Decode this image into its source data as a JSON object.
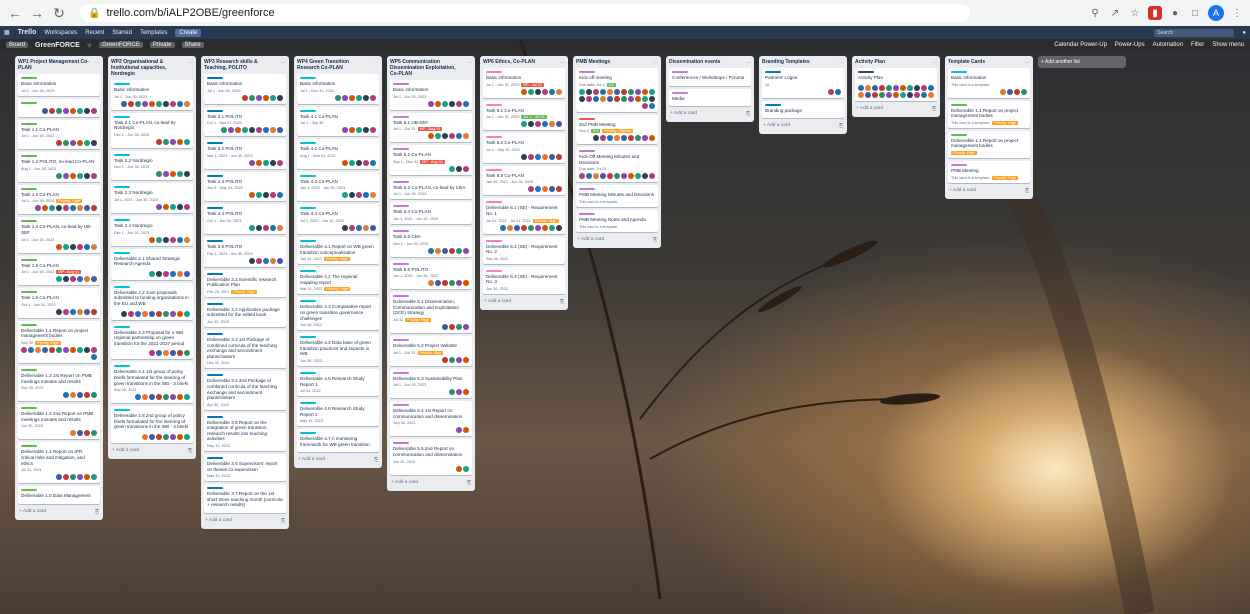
{
  "browser": {
    "url": "trello.com/b/iALP2OBE/greenforce",
    "back_icon": "arrow-left-icon",
    "profile_initial": "A"
  },
  "topbar": {
    "logo": "Trello",
    "workspaces": "Workspaces",
    "recent": "Recent",
    "starred": "Starred",
    "templates": "Templates",
    "create": "Create",
    "search": "Search"
  },
  "board": {
    "view": "Board",
    "title": "GreenFORCE",
    "workspace": "GreenFORCE",
    "private": "Private",
    "share": "Share",
    "calendar": "Calendar Power-Up",
    "powerups": "Power-Ups",
    "automation": "Automation",
    "filter": "Filter",
    "show_menu": "Show menu"
  },
  "add_card_label": "+ Add a card",
  "add_list_label": "+ Add another list",
  "lists": [
    {
      "title": "WP1 Project Management Co-PLAN",
      "cards": [
        {
          "title": "Basic information",
          "label": "#61bd4f",
          "badges": "Jul 1 - Jun 30, 2023",
          "avatars": 0
        },
        {
          "title": "",
          "label": "#61bd4f",
          "badges": "",
          "avatars": 8
        },
        {
          "title": "Task 1.1 Co-PLAN",
          "label": "#61bd4f",
          "badges": "Jul 1 - Jun 30, 2023",
          "avatars": 6
        },
        {
          "title": "Task 1.2 POLITO, no lead Co-PLAN",
          "label": "#61bd4f",
          "badges": "Aug 1 - Jun 30, 2023",
          "avatars": 6
        },
        {
          "title": "Task 1.3 Co-PLAN",
          "label": "#61bd4f",
          "badges": "Jul 1 - Jun 30, 2023",
          "prio": "Priority: High",
          "avatars": 9
        },
        {
          "title": "Task 1.4 Co-PLAN, co-lead by UB-SEF",
          "label": "#61bd4f",
          "badges": "Jul 1 - Jun 30, 2023",
          "avatars": 6
        },
        {
          "title": "Task 1.5 Co-PLAN",
          "label": "#61bd4f",
          "badges": "Jul 1 - Jun 30, 2023",
          "red": "MP - Aug 01",
          "avatars": 6
        },
        {
          "title": "Task 1.6 Co-PLAN",
          "label": "#61bd4f",
          "badges": "Oct 1 - Jun 30, 2023",
          "avatars": 6
        },
        {
          "title": "Deliverable 1.1 Report on project management bodies",
          "label": "#61bd4f",
          "badges": "Sep 30",
          "prio": "Priority: High",
          "avatars": 12
        },
        {
          "title": "Deliverable 1.2 1st Report on PMB meetings minutes and results",
          "label": "#61bd4f",
          "badges": "Sep 30, 2021",
          "avatars": 5
        },
        {
          "title": "Deliverable 1.3 2nd Report on PMB meetings minutes and results",
          "label": "#61bd4f",
          "badges": "Jun 30, 2023",
          "avatars": 4
        },
        {
          "title": "Deliverable 1.4 Report on IPR, critical risks and mitigation, and ethics",
          "label": "#61bd4f",
          "badges": "Jul 31, 2021",
          "avatars": 6
        },
        {
          "title": "Deliverable 1.5 Data Management",
          "label": "#61bd4f",
          "badges": "",
          "avatars": 0
        }
      ]
    },
    {
      "title": "WP2 Organisational & Institutional capacities, Nordregio",
      "cards": [
        {
          "title": "Basic information",
          "label": "#00c2e0",
          "badges": "Jul 1 - Jun 30, 2023",
          "avatars": 10
        },
        {
          "title": "Task 2.1 Co-PLAN, co-lead by Nordregio",
          "label": "#00c2e0",
          "badges": "Dec 1 - Jun 30, 2023",
          "avatars": 5
        },
        {
          "title": "Task 2.2 Nordregio",
          "label": "#00c2e0",
          "badges": "Nov 1 - Jun 30, 2023",
          "avatars": 5
        },
        {
          "title": "Task 2.3 Nordregio",
          "label": "#00c2e0",
          "badges": "Jul 1, 2021 - Jun 30, 2023",
          "avatars": 5
        },
        {
          "title": "Task 2.4 Nordregio",
          "label": "#00c2e0",
          "badges": "Dec 1 - Jun 30, 2023",
          "avatars": 6
        },
        {
          "title": "Deliverable 2.1 Shared Strategic Research Agenda",
          "label": "#00c2e0",
          "badges": "",
          "avatars": 6
        },
        {
          "title": "Deliverable 2.2 Joint proposals submitted to funding organisations in the EU and WB",
          "label": "#00c2e0",
          "badges": "",
          "avatars": 10
        },
        {
          "title": "Deliverable 2.3 Proposal for a WB regional partnership on green transition for the 2021-2027 period",
          "label": "#00c2e0",
          "badges": "",
          "avatars": 6
        },
        {
          "title": "Deliverable 2.4 1st group of policy briefs formulated for the steering of green transitions in the WB - 3 briefs",
          "label": "#00c2e0",
          "badges": "Sep 30, 2021",
          "avatars": 8
        },
        {
          "title": "Deliverable 2.5 2nd group of policy briefs formulated for the steering of green transitions in the WB - 3 briefs",
          "label": "#00c2e0",
          "badges": "",
          "avatars": 7
        }
      ]
    },
    {
      "title": "WP3 Research skills & Teaching, POLITO",
      "cards": [
        {
          "title": "Basic information",
          "label": "#0079bf",
          "badges": "Jul 1 - Jun 30, 2023",
          "avatars": 6
        },
        {
          "title": "Task 3.1 POLITO",
          "label": "#0079bf",
          "badges": "Oct 1 - Mar 31, 2023",
          "avatars": 9
        },
        {
          "title": "Task 3.2 POLITO",
          "label": "#0079bf",
          "badges": "Mar 1, 2023 - Jun 30, 2023",
          "avatars": 5
        },
        {
          "title": "Task 3.3 POLITO",
          "label": "#0079bf",
          "badges": "Jan 9 - May 31, 2023",
          "avatars": 5
        },
        {
          "title": "Task 3.4 POLITO",
          "label": "#0079bf",
          "badges": "Oct 1 - Jun 30, 2023",
          "avatars": 5
        },
        {
          "title": "Task 3.5 POLITO",
          "label": "#0079bf",
          "badges": "Feb 1, 2023 - Jun 30, 2023",
          "avatars": 5
        },
        {
          "title": "Deliverable 3.1 Scientific research Publication Plan",
          "label": "#0079bf",
          "badges": "Feb 28, 2021",
          "prio": "Priority: High",
          "avatars": 0
        },
        {
          "title": "Deliverable 3.2 Application package submitted for the edited book",
          "label": "#0079bf",
          "badges": "Jun 30, 2023",
          "avatars": 0
        },
        {
          "title": "Deliverable 3.3 1st Package of combined curricula of the teaching exchange and secondment plans/clusters",
          "label": "#0079bf",
          "badges": "Dec 31, 2021",
          "avatars": 0
        },
        {
          "title": "Deliverable 3.4 2nd Package of combined curricula of the teaching exchange and secondment plans/clusters",
          "label": "#0079bf",
          "badges": "Apr 30, 2023",
          "avatars": 0
        },
        {
          "title": "Deliverable 3.5 Report on the integration of green transition research results into teaching activities",
          "label": "#0079bf",
          "badges": "May 31, 2023",
          "avatars": 0
        },
        {
          "title": "Deliverable 3.6 Supervisors' report on theses co-supervision",
          "label": "#0079bf",
          "badges": "May 31, 2023",
          "avatars": 0
        },
        {
          "title": "Deliverable 3.7 Report on the 1st short stone teaching month (curricula + research results)",
          "label": "#0079bf",
          "badges": "",
          "avatars": 0
        }
      ]
    },
    {
      "title": "WP4 Green Transition Research Co-PLAN",
      "cards": [
        {
          "title": "Basic information",
          "label": "#00c2e0",
          "badges": "Jul 1 - Dec 31, 2022",
          "avatars": 6
        },
        {
          "title": "Task 4.1 Co-PLAN",
          "label": "#00c2e0",
          "badges": "Jul 1 - Sep 30",
          "avatars": 5
        },
        {
          "title": "Task 4.2 Co-PLAN",
          "label": "#00c2e0",
          "badges": "Aug 1 - Mar 31, 2022",
          "avatars": 5
        },
        {
          "title": "Task 4.3 Co-PLAN",
          "label": "#00c2e0",
          "badges": "Jan 1, 2022 - Jun 30, 2023",
          "avatars": 5
        },
        {
          "title": "Task 4.4 Co-PLAN",
          "label": "#00c2e0",
          "badges": "Jul 1, 2022 - Jun 30, 2023",
          "avatars": 5
        },
        {
          "title": "Deliverable 4.1 Report on WB green transition conceptualisation",
          "label": "#00c2e0",
          "badges": "Jan 31, 2021",
          "prio": "Priority: High",
          "avatars": 0
        },
        {
          "title": "Deliverable 4.2 The regional mapping report",
          "label": "#00c2e0",
          "badges": "Mar 31, 2022",
          "prio": "Priority: High",
          "avatars": 0
        },
        {
          "title": "Deliverable 4.3 Comparative report on green transition governance challenges",
          "label": "#00c2e0",
          "badges": "Jun 30, 2023",
          "avatars": 0
        },
        {
          "title": "Deliverable 4.4 Data base of green transition practices and impacts in WB",
          "label": "#00c2e0",
          "badges": "Jun 30, 2023",
          "avatars": 0
        },
        {
          "title": "Deliverable 4.5 Research Study Report 1",
          "label": "#00c2e0",
          "badges": "Jul 31, 2022",
          "avatars": 0
        },
        {
          "title": "Deliverable 4.6 Research Study Report 2",
          "label": "#00c2e0",
          "badges": "May 31, 2023",
          "avatars": 0
        },
        {
          "title": "Deliverable 4.7 A monitoring framework for WB green transition",
          "label": "#00c2e0",
          "badges": "",
          "avatars": 0
        }
      ]
    },
    {
      "title": "WP5 Communication Dissemination Exploitation, Co-PLAN",
      "cards": [
        {
          "title": "Basic information",
          "label": "#c377e0",
          "badges": "Jul 1 - Jun 30, 2023",
          "avatars": 6
        },
        {
          "title": "Task 5.1 UB-SEF",
          "label": "#c377e0",
          "badges": "Jul 1 - Oct 31",
          "red": "MP - Aug 01",
          "avatars": 6
        },
        {
          "title": "Task 5.2 Co-PLAN",
          "label": "#c377e0",
          "badges": "Sep 1 - Mar 31",
          "red": "MP - Aug 01",
          "avatars": 3
        },
        {
          "title": "Task 5.3 Co-PLAN, co-lead by CBA",
          "label": "#c377e0",
          "badges": "Jul 1 - Jun 30, 2023",
          "avatars": 0
        },
        {
          "title": "Task 5.4 Co-PLAN",
          "label": "#c377e0",
          "badges": "Jan 1, 2021 - Jun 30, 2023",
          "avatars": 0
        },
        {
          "title": "Task 5.5 CBA",
          "label": "#c377e0",
          "badges": "Nov 1 - Jun 30, 2023",
          "avatars": 6
        },
        {
          "title": "Task 5.6 POLITO",
          "label": "#c377e0",
          "badges": "Jan 1, 2021 - Jun 30, 2023",
          "avatars": 6
        },
        {
          "title": "Deliverable 5.1 Dissemination, Communication and Exploitation (DCE) Strategy",
          "label": "#c377e0",
          "badges": "Jul 31",
          "prio": "Priority: High",
          "avatars": 4
        },
        {
          "title": "Deliverable 5.2 Project Website",
          "label": "#c377e0",
          "badges": "Jul 1 - Oct 31",
          "prio": "Priority: High",
          "avatars": 4
        },
        {
          "title": "Deliverable 5.3 Sustainability Plan",
          "label": "#c377e0",
          "badges": "Jul 1 - Jun 30, 2023",
          "avatars": 3
        },
        {
          "title": "Deliverable 5.4 1st Report on communication and dissemination",
          "label": "#c377e0",
          "badges": "Sep 30, 2021",
          "avatars": 2
        },
        {
          "title": "Deliverable 5.5 2nd Report on communication and dissemination",
          "label": "#c377e0",
          "badges": "Jun 30, 2023",
          "avatars": 2
        }
      ]
    },
    {
      "title": "WP6 Ethics, Co-PLAN",
      "cards": [
        {
          "title": "Basic information",
          "label": "#ff78cb",
          "badges": "Jul 1 - Jun 30, 2023",
          "red": "RP - Jul 31",
          "avatars": 6
        },
        {
          "title": "Task 6.1 Co-PLAN",
          "label": "#ff78cb",
          "badges": "Jul 1 - Jun 30, 2023",
          "green": "Jul 1 - Jul 31",
          "avatars": 6
        },
        {
          "title": "Task 6.2 Co-PLAN",
          "label": "#ff78cb",
          "badges": "Jul 1 - Sep 30, 2021",
          "avatars": 6
        },
        {
          "title": "Task 6.3 Co-PLAN",
          "label": "#ff78cb",
          "badges": "Jan 30, 2021 - Jun 30, 2023",
          "avatars": 5
        },
        {
          "title": "Deliverable 6.1 (SE) - Requirement No. 1",
          "label": "#ff78cb",
          "badges": "Jul 31, 2021 - Jul 31, 2021",
          "prio": "Priority: High",
          "avatars": 9
        },
        {
          "title": "Deliverable 6.2 (SE) - Requirement No. 2",
          "label": "#ff78cb",
          "badges": "Sep 30, 2021",
          "avatars": 0
        },
        {
          "title": "Deliverable 6.3 (SE) - Requirement No. 3",
          "label": "#ff78cb",
          "badges": "Jun 30, 2023",
          "avatars": 0
        }
      ]
    },
    {
      "title": "PMB Meetings",
      "cards": [
        {
          "title": "Kick-off meeting",
          "label": "#c377e0",
          "badges": "Due date: Jul 1",
          "green": "4/4",
          "avatars": 24
        },
        {
          "title": "2nd PMB Meeting",
          "label": "#eb5a46",
          "badges": "Sep 2",
          "green": "0/4",
          "prio": "Priority: Highest",
          "avatars": 9
        },
        {
          "title": "Kick-Off Meeting Minutes and Decisions",
          "label": "#c377e0",
          "badges": "Due date: Jul 24",
          "avatars": 11
        },
        {
          "title": "PMB Meeting Minutes and Decisions",
          "label": "#c377e0",
          "badges": "This card is a template.",
          "avatars": 0
        },
        {
          "title": "PMB Meeting Notes and Agenda",
          "label": "#c377e0",
          "badges": "This card is a template.",
          "avatars": 0
        }
      ]
    },
    {
      "title": "Dissemination events",
      "cards": [
        {
          "title": "Conferences / Workshops / Forums",
          "label": "#c377e0",
          "badges": "",
          "avatars": 0
        },
        {
          "title": "Media",
          "label": "#c377e0",
          "badges": "",
          "avatars": 0
        }
      ]
    },
    {
      "title": "Branding Templates",
      "cards": [
        {
          "title": "Partners' Logos",
          "label": "#0079bf",
          "badges": "15",
          "avatars": 2
        },
        {
          "title": "Branding package",
          "label": "#0079bf",
          "badges": "",
          "avatars": 0
        }
      ]
    },
    {
      "title": "Activity Plan",
      "cards": [
        {
          "title": "Activity Plan",
          "label": "#344563",
          "badges": "",
          "avatars": 22
        }
      ]
    },
    {
      "title": "Template Cards",
      "cards": [
        {
          "title": "Basic information",
          "label": "#00c2e0",
          "badges": "This card is a template.",
          "avatars": 4
        },
        {
          "title": "Deliverable 1.1 Report on project management bodies",
          "label": "#61bd4f",
          "badges": "This card is a template.",
          "prio": "Priority: High",
          "avatars": 0
        },
        {
          "title": "Deliverable 1.1 Report on project management bodies",
          "label": "#61bd4f",
          "badges": "",
          "prio": "Priority: High",
          "avatars": 0
        },
        {
          "title": "PMB Meeting",
          "label": "#c377e0",
          "badges": "This card is a template.",
          "prio": "Priority: High",
          "avatars": 0
        }
      ]
    }
  ],
  "avatar_palette": [
    "#e07b39",
    "#3b5ba5",
    "#c0392b",
    "#2a8f6b",
    "#8e44ad",
    "#d35400",
    "#16a085",
    "#2c3e50",
    "#b03a7a",
    "#1f6fb2"
  ]
}
